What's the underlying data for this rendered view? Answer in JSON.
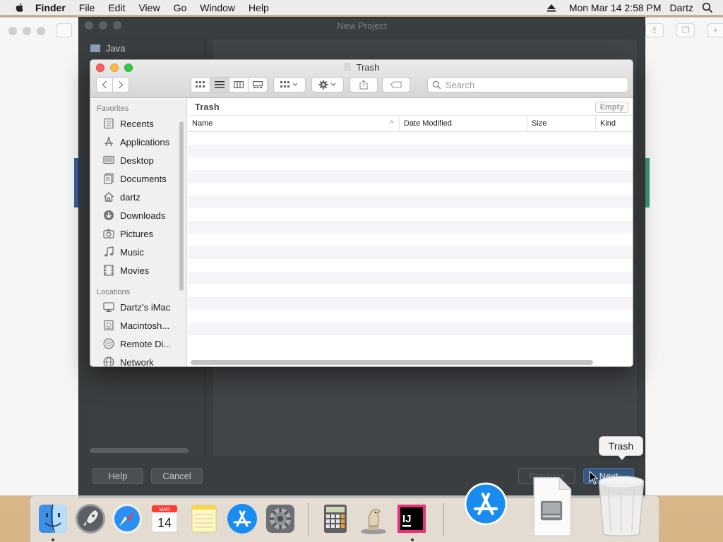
{
  "menubar": {
    "app_name": "Finder",
    "items": [
      "File",
      "Edit",
      "View",
      "Go",
      "Window",
      "Help"
    ],
    "datetime": "Mon Mar 14  2:58 PM",
    "user": "Dartz"
  },
  "ide_dialog": {
    "title": "New Project",
    "sidebar_item": "Java",
    "help_label": "Help",
    "cancel_label": "Cancel",
    "previous_label": "Previous",
    "next_label": "Next"
  },
  "finder": {
    "title": "Trash",
    "search_placeholder": "Search",
    "path_label": "Trash",
    "empty_label": "Empty",
    "columns": [
      "Name",
      "Date Modified",
      "Size",
      "Kind"
    ],
    "favorites_header": "Favorites",
    "favorites": [
      {
        "label": "Recents",
        "icon": "recents-icon"
      },
      {
        "label": "Applications",
        "icon": "applications-icon"
      },
      {
        "label": "Desktop",
        "icon": "desktop-icon"
      },
      {
        "label": "Documents",
        "icon": "documents-icon"
      },
      {
        "label": "dartz",
        "icon": "home-icon"
      },
      {
        "label": "Downloads",
        "icon": "downloads-icon"
      },
      {
        "label": "Pictures",
        "icon": "pictures-icon"
      },
      {
        "label": "Music",
        "icon": "music-icon"
      },
      {
        "label": "Movies",
        "icon": "movies-icon"
      }
    ],
    "locations_header": "Locations",
    "locations": [
      {
        "label": "Dartz’s iMac",
        "icon": "imac-icon"
      },
      {
        "label": "Macintosh...",
        "icon": "disk-icon"
      },
      {
        "label": "Remote Di...",
        "icon": "remote-disc-icon"
      },
      {
        "label": "Network",
        "icon": "network-icon"
      }
    ]
  },
  "tooltip": {
    "text": "Trash"
  },
  "dock": {
    "calendar_month": "MAR",
    "calendar_day": "14",
    "intellij_label": "IJ"
  },
  "colors": {
    "ide_bg": "#3b3e40",
    "finder_close": "#fc605c",
    "finder_minimize": "#fdbc40",
    "finder_zoom": "#34c84a",
    "ide_primary": "#365880"
  }
}
